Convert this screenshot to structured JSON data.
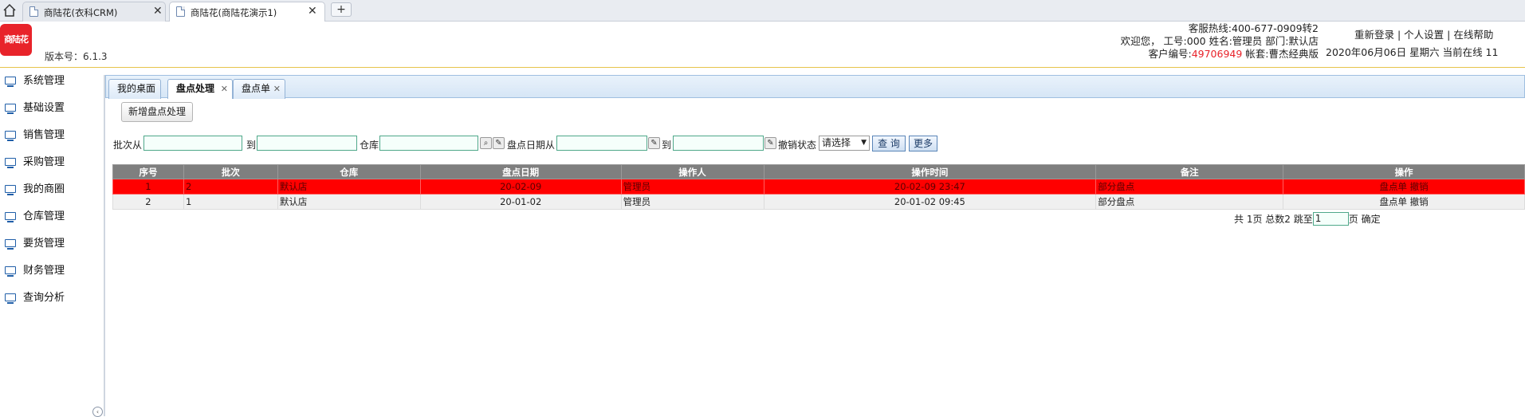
{
  "browser": {
    "tabs": [
      {
        "title": "商陆花(衣科CRM)",
        "active": false
      },
      {
        "title": "商陆花(商陆花演示1)",
        "active": true
      }
    ],
    "new_tab_symbol": "+"
  },
  "header": {
    "logo_text": "商陆花",
    "version": "版本号：6.1.3",
    "hotline": "客服热线:400-677-0909转2",
    "welcome": "欢迎您， 工号:000 姓名:管理员 部门:默认店",
    "customer_label": "客户编号:",
    "customer_no": "49706949",
    "account": " 帐套:曹杰经典版",
    "links": "重新登录 | 个人设置 | 在线帮助",
    "datetime": "2020年06月06日 星期六 当前在线 11"
  },
  "sidebar": {
    "items": [
      {
        "label": "系统管理"
      },
      {
        "label": "基础设置"
      },
      {
        "label": "销售管理"
      },
      {
        "label": "采购管理"
      },
      {
        "label": "我的商圈"
      },
      {
        "label": "仓库管理"
      },
      {
        "label": "要货管理"
      },
      {
        "label": "财务管理"
      },
      {
        "label": "查询分析"
      }
    ]
  },
  "page_tabs": [
    {
      "label": "我的桌面",
      "closable": false,
      "active": false
    },
    {
      "label": "盘点处理",
      "closable": true,
      "active": true
    },
    {
      "label": "盘点单",
      "closable": true,
      "active": false
    }
  ],
  "toolbar": {
    "add_label": "新增盘点处理"
  },
  "filter": {
    "batch_from": "批次从",
    "to1": "到",
    "warehouse": "仓库",
    "date_from": "盘点日期从",
    "to2": "到",
    "cancel_status": "撤销状态",
    "cancel_select": "请选择",
    "query_btn": "查 询",
    "more_btn": "更多"
  },
  "table": {
    "columns": [
      "序号",
      "批次",
      "仓库",
      "盘点日期",
      "操作人",
      "操作时间",
      "备注",
      "操作"
    ],
    "rows": [
      {
        "no": "1",
        "batch": "2",
        "warehouse": "默认店",
        "date": "20-02-09",
        "operator": "管理员",
        "time": "20-02-09 23:47",
        "note": "部分盘点",
        "action1": "盘点单",
        "action2": "撤销",
        "selected": true
      },
      {
        "no": "2",
        "batch": "1",
        "warehouse": "默认店",
        "date": "20-01-02",
        "operator": "管理员",
        "time": "20-01-02 09:45",
        "note": "部分盘点",
        "action1": "盘点单",
        "action2": "撤销",
        "selected": false
      }
    ]
  },
  "pager": {
    "summary": "共 1页 总数2 跳至",
    "page_value": "1",
    "page_unit": "页",
    "confirm": "确定"
  },
  "colors": {
    "accent_red": "#e8232a",
    "selected_row": "#ff0000",
    "header_gray": "#7f7f7f"
  }
}
